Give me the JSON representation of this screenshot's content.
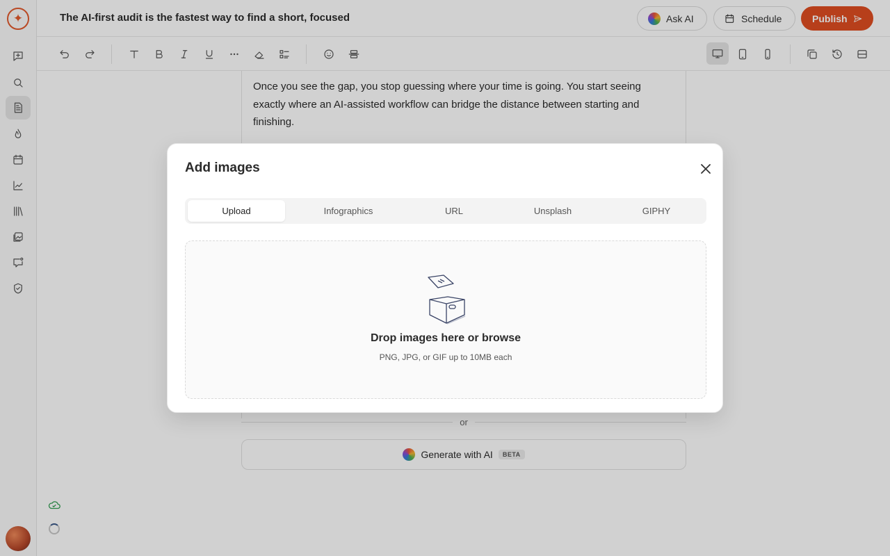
{
  "header": {
    "doc_title": "The AI-first audit is the fastest way to find a short, focused",
    "ask_ai_label": "Ask AI",
    "schedule_label": "Schedule",
    "publish_label": "Publish"
  },
  "editor": {
    "paragraph": "Once you see the gap, you stop guessing where your time is going. You start seeing exactly where an AI-assisted workflow can bridge the distance between starting and finishing.",
    "or_label": "or",
    "generate_label": "Generate with AI",
    "beta_label": "BETA"
  },
  "modal": {
    "title": "Add images",
    "tabs": [
      {
        "label": "Upload",
        "active": true
      },
      {
        "label": "Infographics",
        "active": false
      },
      {
        "label": "URL",
        "active": false
      },
      {
        "label": "Unsplash",
        "active": false
      },
      {
        "label": "GIPHY",
        "active": false
      }
    ],
    "drop_title": "Drop images here or browse",
    "drop_subtitle": "PNG, JPG, or GIF up to 10MB each"
  },
  "colors": {
    "accent": "#e04e21",
    "overlay": "rgba(0,0,0,0.18)",
    "saved": "#2f9e50"
  },
  "sidebar": {
    "items": [
      "new-post-icon",
      "search-icon",
      "document-icon",
      "flame-icon",
      "calendar-icon",
      "analytics-icon",
      "library-icon",
      "media-icon",
      "feedback-icon",
      "shield-icon"
    ],
    "active": "document-icon"
  },
  "toolbar": {
    "icons": [
      "undo-icon",
      "redo-icon",
      "text-icon",
      "bold-icon",
      "italic-icon",
      "underline-icon",
      "more-icon",
      "eraser-icon",
      "checklist-icon",
      "emoji-icon",
      "align-center-icon",
      "desktop-icon",
      "tablet-icon",
      "mobile-icon",
      "copy-icon",
      "history-icon",
      "panel-icon"
    ],
    "active_view": "desktop-icon"
  }
}
